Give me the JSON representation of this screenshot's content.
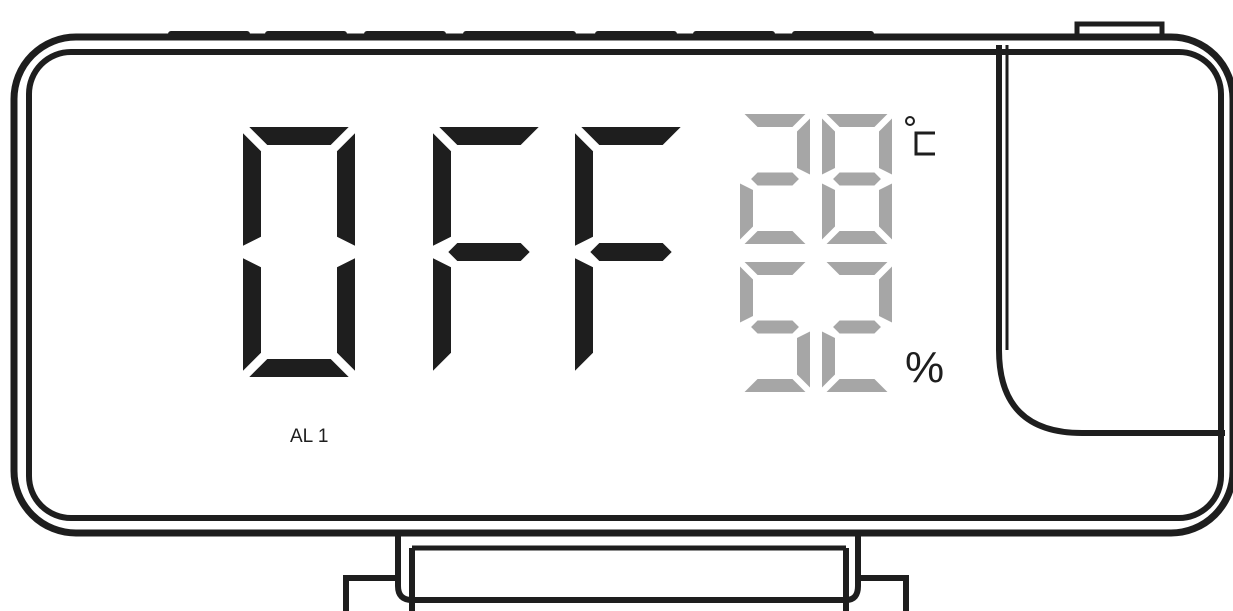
{
  "display": {
    "main_text": [
      "0",
      "F",
      "F"
    ],
    "alarm_label": "AL 1",
    "temperature": {
      "digits": [
        "2",
        "8"
      ],
      "unit": "°C"
    },
    "humidity": {
      "digits": [
        "5",
        "2"
      ],
      "unit": "%"
    }
  },
  "colors": {
    "outline": "#1e1e1e",
    "main_segment": "#1e1e1e",
    "dim_segment": "#a6a6a6",
    "background": "#ffffff"
  },
  "icons": [
    "projector-window",
    "stand",
    "top-button"
  ]
}
